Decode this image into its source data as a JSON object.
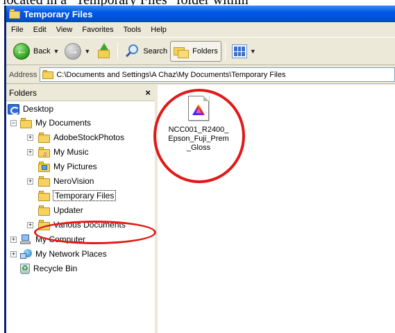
{
  "page_caption": "located in a \"Temporary Files\" folder within",
  "window": {
    "title": "Temporary Files",
    "menu": [
      "File",
      "Edit",
      "View",
      "Favorites",
      "Tools",
      "Help"
    ],
    "toolbar": {
      "back_label": "Back",
      "search_label": "Search",
      "folders_label": "Folders"
    },
    "address": {
      "label": "Address",
      "value": "C:\\Documents and Settings\\A Chaz\\My Documents\\Temporary Files"
    }
  },
  "folders_pane": {
    "title": "Folders",
    "close": "×",
    "tree": [
      {
        "label": "Desktop",
        "icon": "desktop-icon"
      },
      {
        "label": "My Documents",
        "icon": "documents-folder-icon"
      },
      {
        "label": "AdobeStockPhotos",
        "icon": "folder-icon"
      },
      {
        "label": "My Music",
        "icon": "music-folder-icon"
      },
      {
        "label": "My Pictures",
        "icon": "pictures-folder-icon"
      },
      {
        "label": "NeroVision",
        "icon": "folder-icon"
      },
      {
        "label": "Temporary Files",
        "icon": "folder-open-icon",
        "selected": true
      },
      {
        "label": "Updater",
        "icon": "folder-icon"
      },
      {
        "label": "Various Documents",
        "icon": "folder-icon"
      },
      {
        "label": "My Computer",
        "icon": "computer-icon"
      },
      {
        "label": "My Network Places",
        "icon": "network-icon"
      },
      {
        "label": "Recycle Bin",
        "icon": "recycle-bin-icon"
      }
    ]
  },
  "files": [
    {
      "name": "NCC001_R2400_Epson_Fuji_Prem_Gloss",
      "icon": "color-profile-file-icon"
    }
  ],
  "colors": {
    "titlebar": "#0058e6",
    "highlight_circle": "#e31818",
    "window_chrome": "#ece9d8"
  }
}
